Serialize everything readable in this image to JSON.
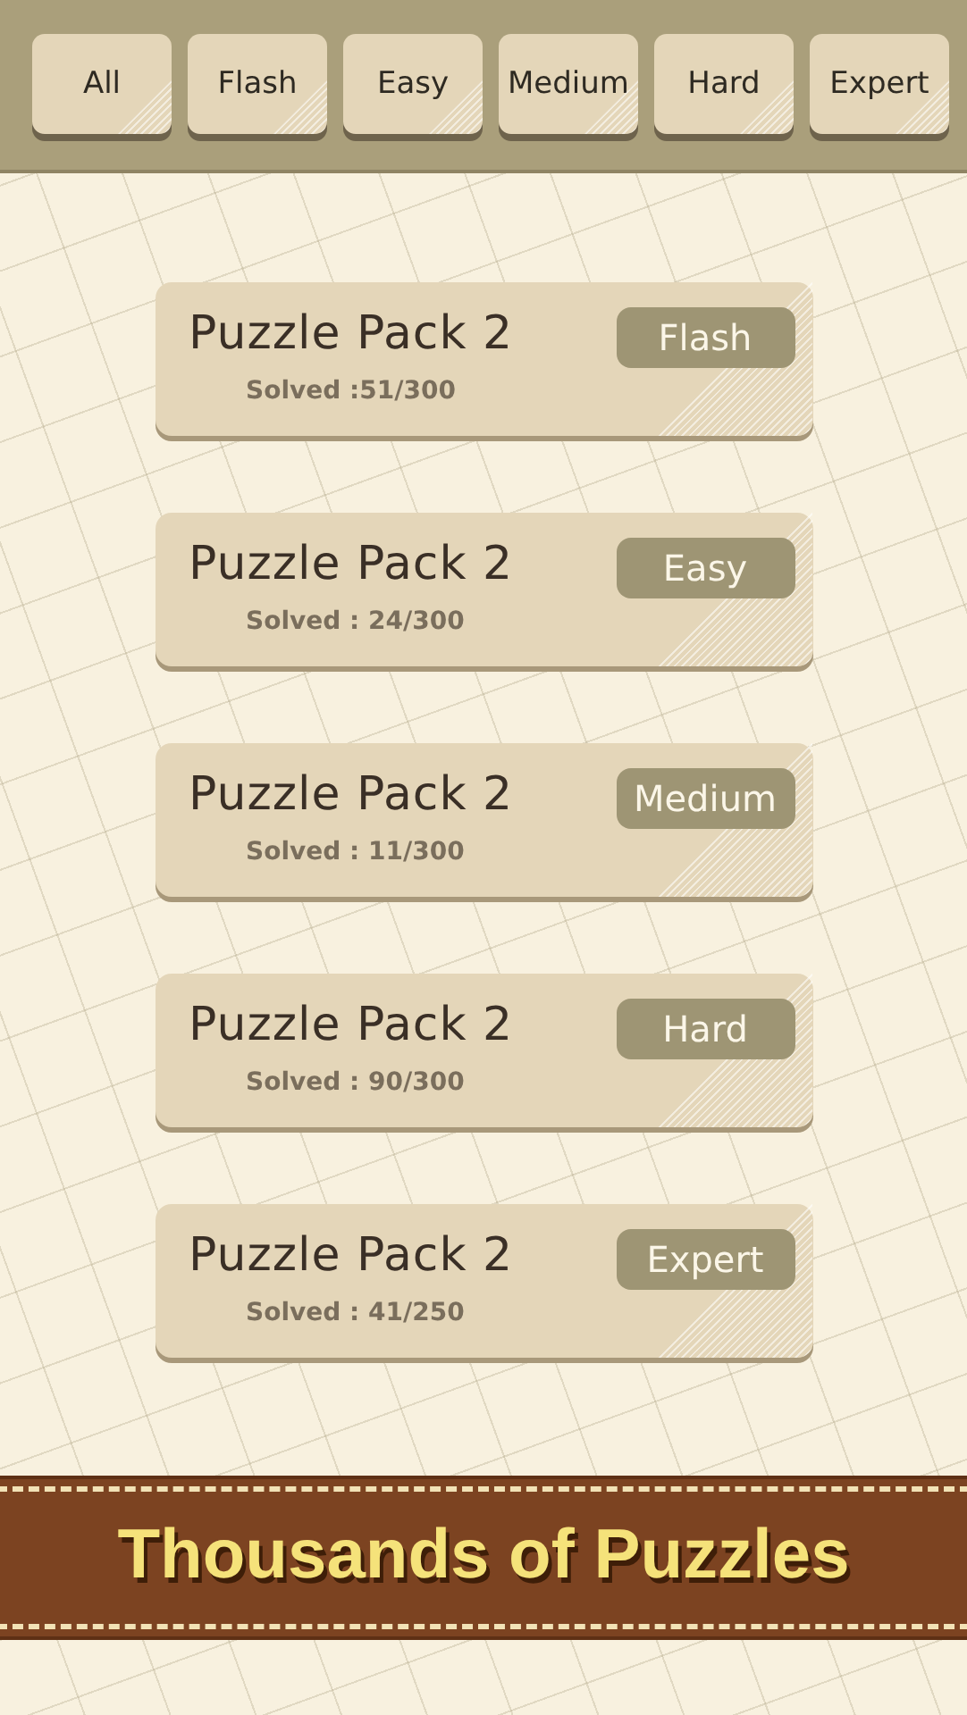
{
  "tabs": [
    {
      "label": "All",
      "selected": false
    },
    {
      "label": "Flash",
      "selected": false
    },
    {
      "label": "Easy",
      "selected": false
    },
    {
      "label": "Medium",
      "selected": false
    },
    {
      "label": "Hard",
      "selected": false
    },
    {
      "label": "Expert",
      "selected": false
    }
  ],
  "packs": [
    {
      "title": "Puzzle Pack 2",
      "solved": "Solved :51/300",
      "badge": "Flash"
    },
    {
      "title": "Puzzle Pack 2",
      "solved": "Solved : 24/300",
      "badge": "Easy"
    },
    {
      "title": "Puzzle Pack 2",
      "solved": "Solved : 11/300",
      "badge": "Medium"
    },
    {
      "title": "Puzzle Pack 2",
      "solved": "Solved : 90/300",
      "badge": "Hard"
    },
    {
      "title": "Puzzle Pack 2",
      "solved": "Solved : 41/250",
      "badge": "Expert"
    }
  ],
  "banner": {
    "text": "Thousands of Puzzles"
  }
}
